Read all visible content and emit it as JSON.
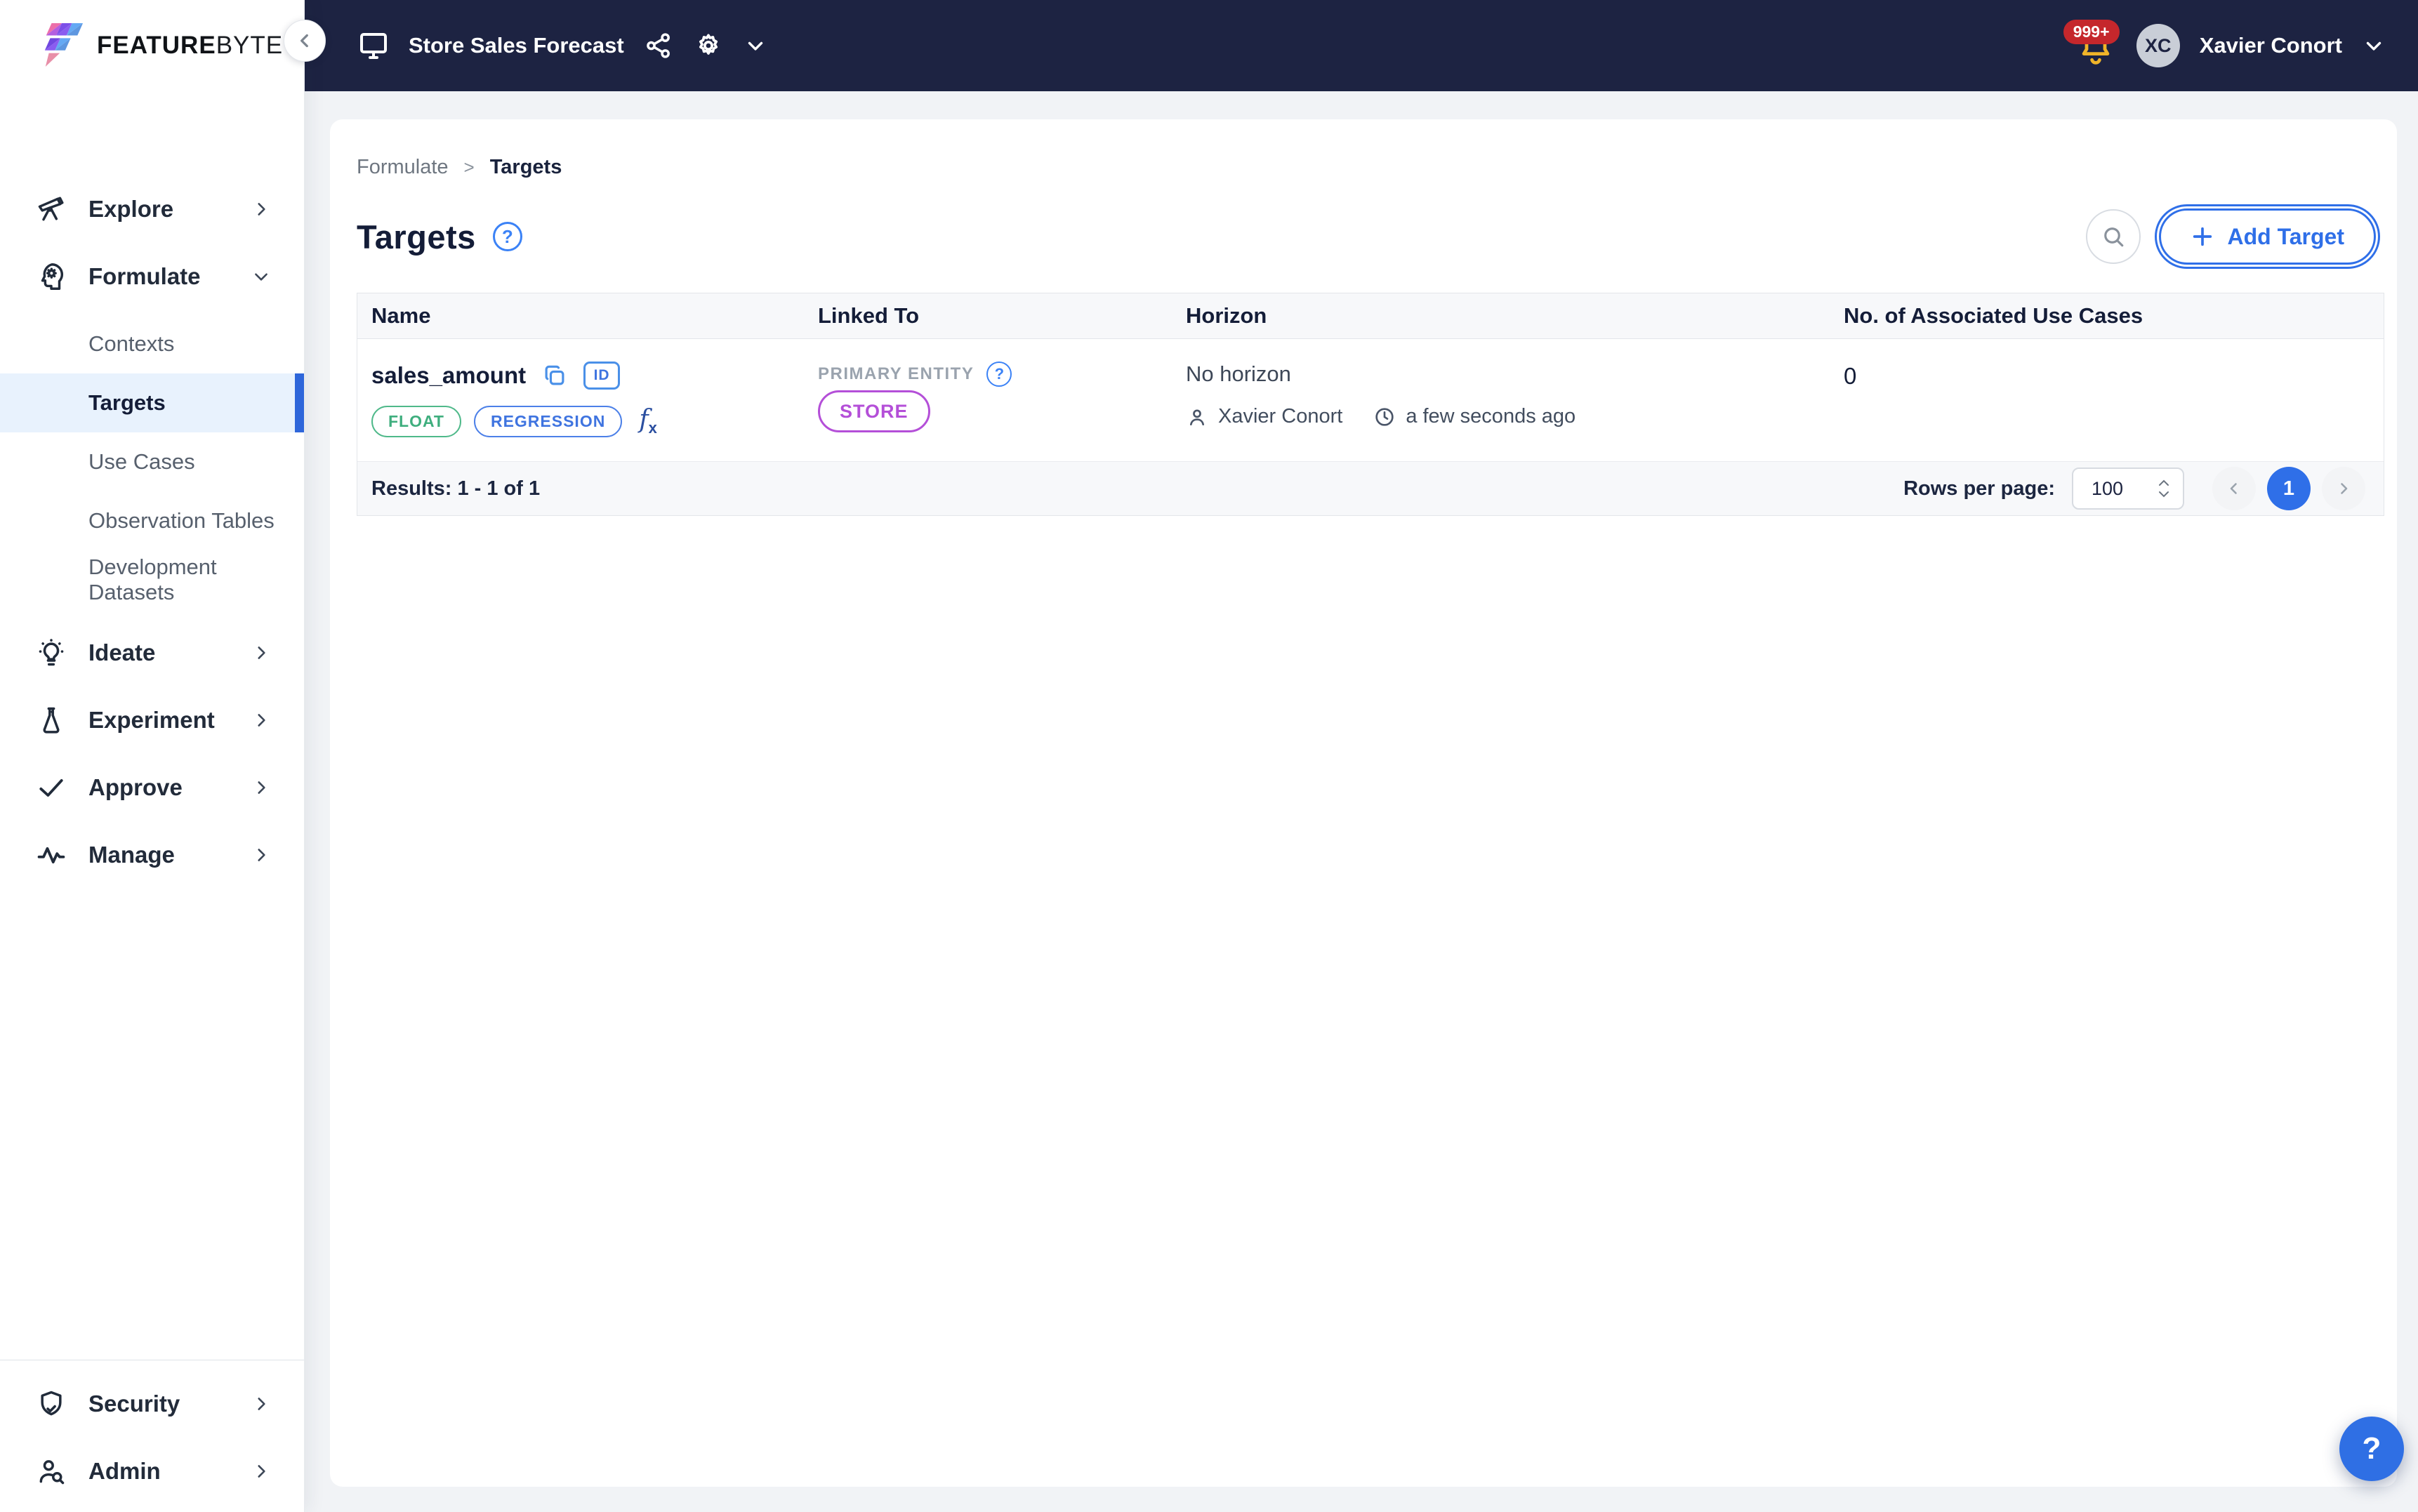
{
  "brand": {
    "wordmark_bold": "FEATURE",
    "wordmark_light": "BYTE"
  },
  "topbar": {
    "catalog_name": "Store Sales Forecast",
    "notifications_badge": "999+",
    "user": {
      "initials": "XC",
      "name": "Xavier Conort"
    }
  },
  "sidebar": {
    "items": [
      {
        "label": "Explore",
        "icon": "telescope-icon"
      },
      {
        "label": "Formulate",
        "icon": "head-gear-icon",
        "expanded": true
      },
      {
        "label": "Ideate",
        "icon": "lightbulb-icon"
      },
      {
        "label": "Experiment",
        "icon": "flask-icon"
      },
      {
        "label": "Approve",
        "icon": "check-icon"
      },
      {
        "label": "Manage",
        "icon": "activity-icon"
      },
      {
        "label": "Security",
        "icon": "shield-check-icon"
      },
      {
        "label": "Admin",
        "icon": "user-search-icon"
      }
    ],
    "formulate_subitems": [
      {
        "label": "Contexts",
        "active": false
      },
      {
        "label": "Targets",
        "active": true
      },
      {
        "label": "Use Cases",
        "active": false
      },
      {
        "label": "Observation Tables",
        "active": false
      },
      {
        "label": "Development Datasets",
        "active": false
      }
    ]
  },
  "page": {
    "breadcrumb": {
      "parent": "Formulate",
      "separator": ">",
      "current": "Targets"
    },
    "title": "Targets",
    "add_button_label": "Add Target"
  },
  "table": {
    "columns": [
      "Name",
      "Linked To",
      "Horizon",
      "No. of Associated Use Cases"
    ],
    "rows": [
      {
        "name": "sales_amount",
        "id_icon_label": "ID",
        "tags": [
          {
            "label": "FLOAT",
            "color": "green"
          },
          {
            "label": "REGRESSION",
            "color": "blue"
          }
        ],
        "fx_label": "f",
        "fx_sub": "x",
        "linked_to_label": "PRIMARY ENTITY",
        "entity": "STORE",
        "horizon": "No horizon",
        "author": "Xavier Conort",
        "updated": "a few seconds ago",
        "use_cases_count": "0"
      }
    ],
    "footer": {
      "results": "Results: 1 - 1 of 1",
      "rows_per_page_label": "Rows per page:",
      "rows_per_page_value": "100",
      "current_page": "1"
    }
  },
  "help_fab_label": "?",
  "colors": {
    "topbar_navy": "#1d2342",
    "accent_blue": "#2f6fe8",
    "active_item_bg": "#e8f2fd",
    "active_item_bar": "#2e66da",
    "tag_green": "#4fb98a",
    "tag_blue": "#4c80e8",
    "entity_purple": "#b44fd8",
    "badge_red": "#c5272c",
    "bell_amber": "#f0b429",
    "page_bg": "#f1f3f6"
  }
}
